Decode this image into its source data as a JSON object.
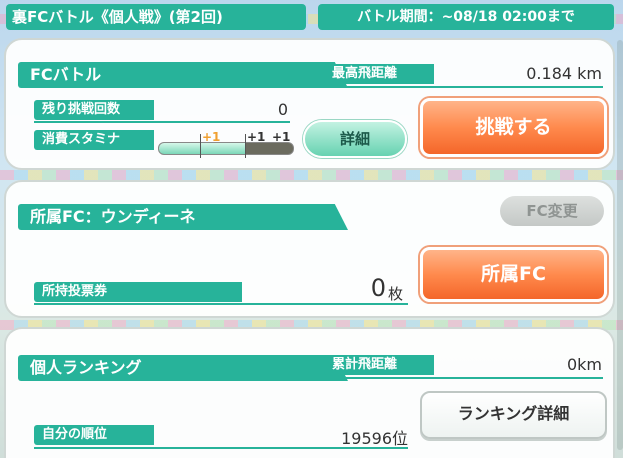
{
  "header": {
    "title": "裏FCバトル《個人戦》(第2回)",
    "period": "バトル期間：~08/18 02:00まで"
  },
  "battle": {
    "section_title": "FCバトル",
    "max_distance_label": "最高飛距離",
    "max_distance_value": "0.184 km",
    "remaining_label": "残り挑戦回数",
    "remaining_value": "0",
    "stamina_label": "消費スタミナ",
    "stamina_marks": [
      "+1",
      "+1",
      "+1"
    ],
    "stamina_fill_fraction": 0.65,
    "detail_button": "詳細",
    "challenge_button": "挑戦する"
  },
  "fc": {
    "section_title": "所属FC：ウンディーネ",
    "change_button": "FC変更",
    "tickets_label": "所持投票券",
    "tickets_value": "0",
    "tickets_unit": "枚",
    "fc_button": "所属FC"
  },
  "ranking": {
    "section_title": "個人ランキング",
    "total_distance_label": "累計飛距離",
    "total_distance_value": "0km",
    "my_rank_label": "自分の順位",
    "my_rank_value": "19596位",
    "ranking_detail_button": "ランキング詳細"
  },
  "colors": {
    "accent": "#27b39a",
    "orange": "#ff8a4d",
    "stamina_mark_orange": "#f0a030"
  }
}
